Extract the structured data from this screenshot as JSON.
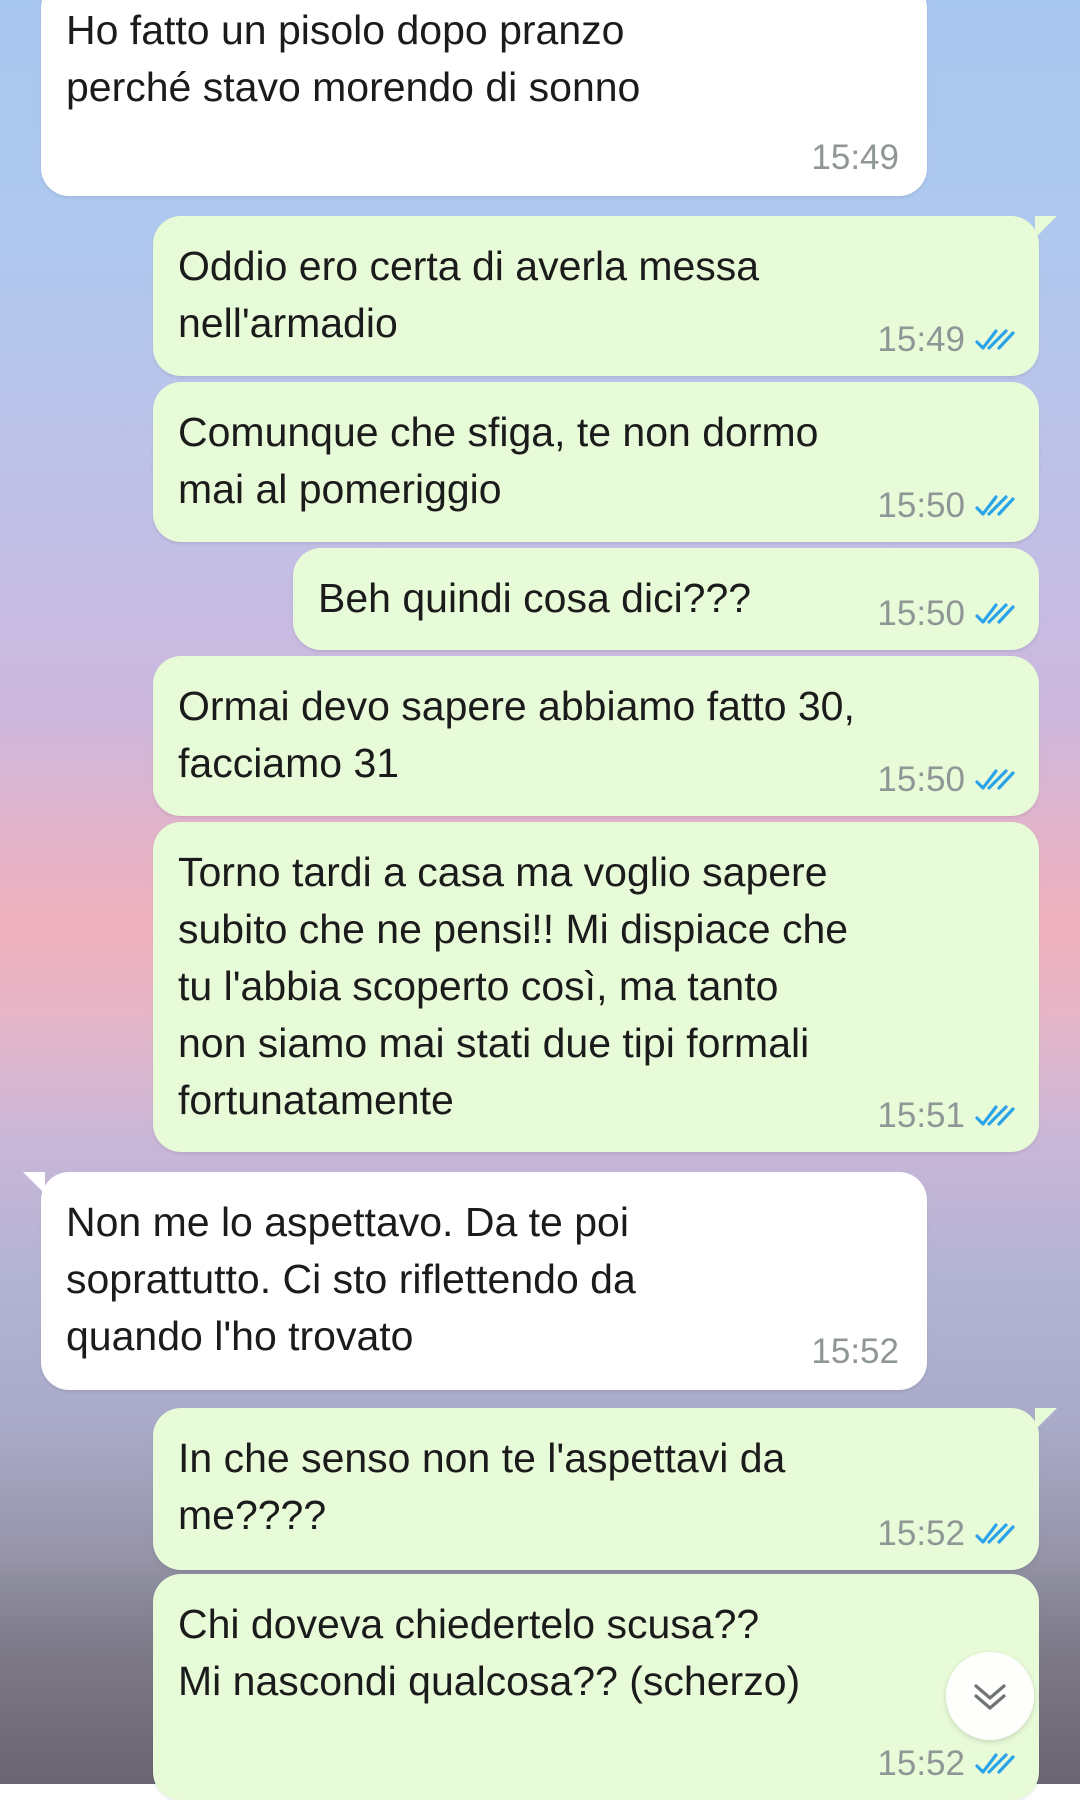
{
  "colors": {
    "incoming_bubble": "#ffffff",
    "outgoing_bubble": "#e8fbd9",
    "timestamp": "#8f9695",
    "read_ticks": "#2aa3e8"
  },
  "messages": [
    {
      "direction": "incoming",
      "text": "Ho fatto un pisolo dopo pranzo\nperché stavo morendo di sonno",
      "time": "15:49"
    },
    {
      "direction": "outgoing",
      "text": "Oddio ero certa di averla messa\nnell'armadio",
      "time": "15:49",
      "status_icon": "double-check-read-icon"
    },
    {
      "direction": "outgoing",
      "text": "Comunque che sfiga, te non dormo\nmai al pomeriggio",
      "time": "15:50",
      "status_icon": "double-check-read-icon"
    },
    {
      "direction": "outgoing",
      "text": "Beh quindi cosa dici???",
      "time": "15:50",
      "status_icon": "double-check-read-icon"
    },
    {
      "direction": "outgoing",
      "text": "Ormai devo sapere abbiamo fatto 30,\nfacciamo 31",
      "time": "15:50",
      "status_icon": "double-check-read-icon"
    },
    {
      "direction": "outgoing",
      "text": "Torno tardi a casa ma voglio sapere\nsubito che ne pensi!! Mi dispiace che\ntu l'abbia scoperto così, ma tanto\nnon siamo mai stati due tipi formali\nfortunatamente",
      "time": "15:51",
      "status_icon": "double-check-read-icon"
    },
    {
      "direction": "incoming",
      "text": "Non me lo aspettavo. Da te poi\nsoprattutto. Ci sto riflettendo da\nquando l'ho trovato",
      "time": "15:52"
    },
    {
      "direction": "outgoing",
      "text": "In che senso non te l'aspettavi da\nme????",
      "time": "15:52",
      "status_icon": "double-check-read-icon"
    },
    {
      "direction": "outgoing",
      "text": "Chi doveva chiedertelo scusa??\nMi nascondi qualcosa?? (scherzo)",
      "time": "15:52",
      "status_icon": "double-check-read-icon"
    }
  ],
  "scroll_button": {
    "icon": "chevron-double-down-icon"
  }
}
